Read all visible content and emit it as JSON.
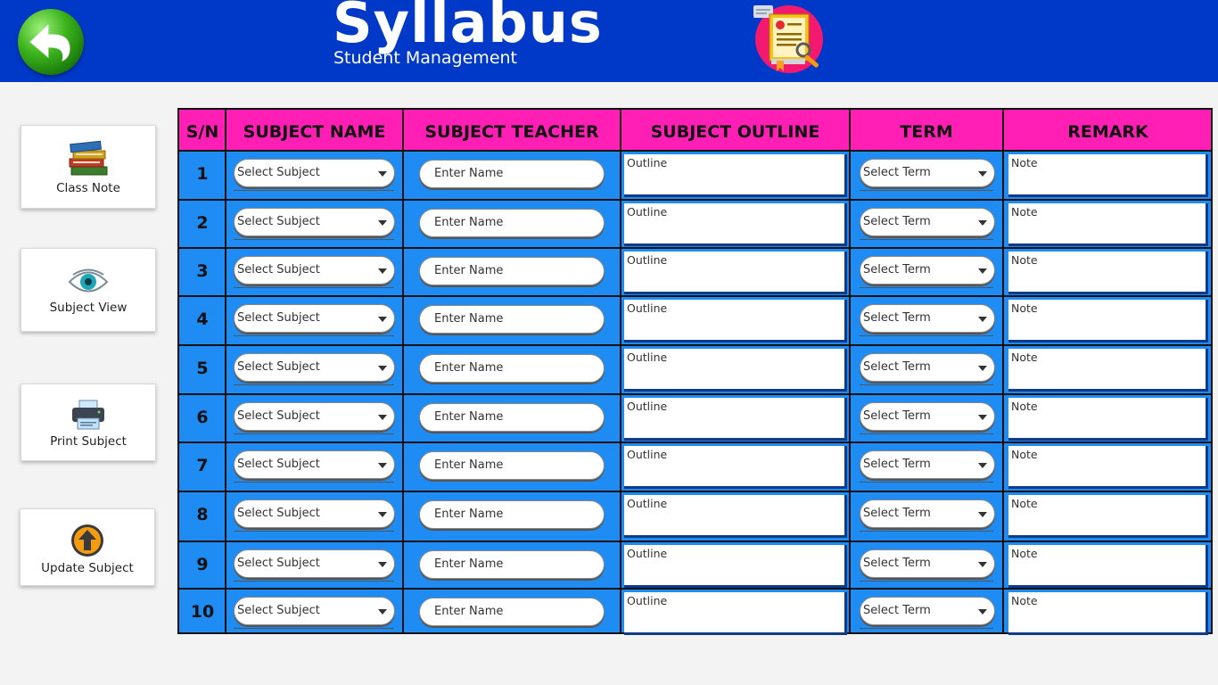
{
  "header": {
    "title": "Syllabus",
    "subtitle": "Student Management",
    "back_icon": "back-arrow-icon",
    "logo_icon": "syllabus-document-icon",
    "background": "#0038c8"
  },
  "sidebar": {
    "items": [
      {
        "label": "Class Note",
        "icon": "books-icon"
      },
      {
        "label": "Subject View",
        "icon": "eye-icon"
      },
      {
        "label": "Print Subject",
        "icon": "printer-icon"
      },
      {
        "label": "Update Subject",
        "icon": "upload-arrow-icon"
      }
    ]
  },
  "table": {
    "header_color": "#ff1fb4",
    "body_color": "#1e8cf2",
    "columns": [
      "S/N",
      "SUBJECT NAME",
      "SUBJECT TEACHER",
      "SUBJECT OUTLINE",
      "TERM",
      "REMARK"
    ],
    "rows": [
      {
        "sn": "1",
        "subject": "Select Subject",
        "teacher": "Enter Name",
        "outline": "Outline",
        "term": "Select Term",
        "remark": "Note"
      },
      {
        "sn": "2",
        "subject": "Select Subject",
        "teacher": "Enter Name",
        "outline": "Outline",
        "term": "Select Term",
        "remark": "Note"
      },
      {
        "sn": "3",
        "subject": "Select Subject",
        "teacher": "Enter Name",
        "outline": "Outline",
        "term": "Select Term",
        "remark": "Note"
      },
      {
        "sn": "4",
        "subject": "Select Subject",
        "teacher": "Enter Name",
        "outline": "Outline",
        "term": "Select Term",
        "remark": "Note"
      },
      {
        "sn": "5",
        "subject": "Select Subject",
        "teacher": "Enter Name",
        "outline": "Outline",
        "term": "Select Term",
        "remark": "Note"
      },
      {
        "sn": "6",
        "subject": "Select Subject",
        "teacher": "Enter Name",
        "outline": "Outline",
        "term": "Select Term",
        "remark": "Note"
      },
      {
        "sn": "7",
        "subject": "Select Subject",
        "teacher": "Enter Name",
        "outline": "Outline",
        "term": "Select Term",
        "remark": "Note"
      },
      {
        "sn": "8",
        "subject": "Select Subject",
        "teacher": "Enter Name",
        "outline": "Outline",
        "term": "Select Term",
        "remark": "Note"
      },
      {
        "sn": "9",
        "subject": "Select Subject",
        "teacher": "Enter Name",
        "outline": "Outline",
        "term": "Select Term",
        "remark": "Note"
      },
      {
        "sn": "10",
        "subject": "Select Subject",
        "teacher": "Enter Name",
        "outline": "Outline",
        "term": "Select Term",
        "remark": "Note"
      }
    ]
  }
}
